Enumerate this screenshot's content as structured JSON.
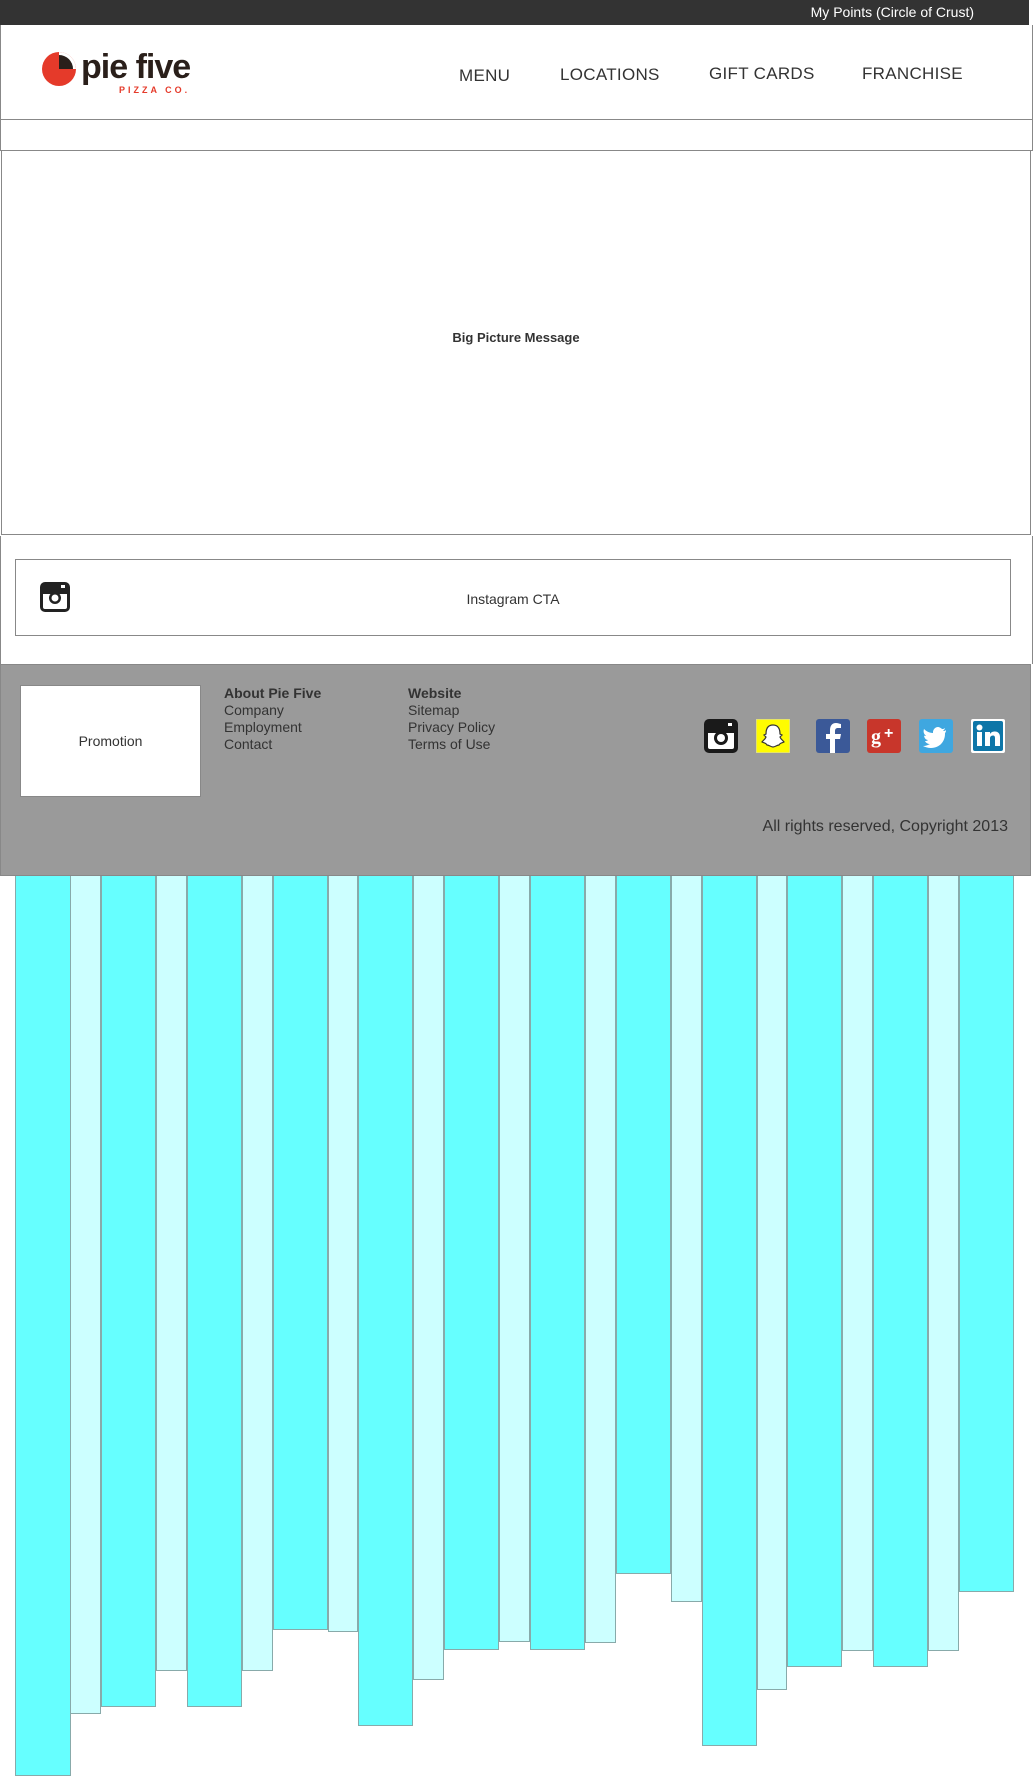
{
  "topbar": {
    "points_link": "My Points (Circle of Crust)"
  },
  "brand": {
    "name": "pie five",
    "sub": "PIZZA CO.",
    "mark": "pie-logo-icon",
    "accent": "#e53a2a",
    "dark": "#2a1f1a"
  },
  "nav": {
    "items": [
      "MENU",
      "LOCATIONS",
      "GIFT CARDS",
      "FRANCHISE"
    ]
  },
  "hero": {
    "message": "Big Picture Message"
  },
  "instagram_cta": {
    "label": "Instagram CTA",
    "icon": "instagram-icon"
  },
  "footer": {
    "promotion": "Promotion",
    "about": {
      "heading": "About Pie Five",
      "links": [
        "Company",
        "Employment",
        "Contact"
      ]
    },
    "website": {
      "heading": "Website",
      "links": [
        "Sitemap",
        "Privacy Policy",
        "Terms of Use"
      ]
    },
    "social": [
      "instagram-icon",
      "snapchat-icon",
      "facebook-icon",
      "google-plus-icon",
      "twitter-icon",
      "linkedin-icon"
    ],
    "copyright": "All rights reserved, Copyright 2013",
    "background": "#9a9a9a"
  },
  "colors": {
    "cyan": "#66ffff",
    "light_cyan": "#ccffff",
    "topbar": "#333333"
  }
}
